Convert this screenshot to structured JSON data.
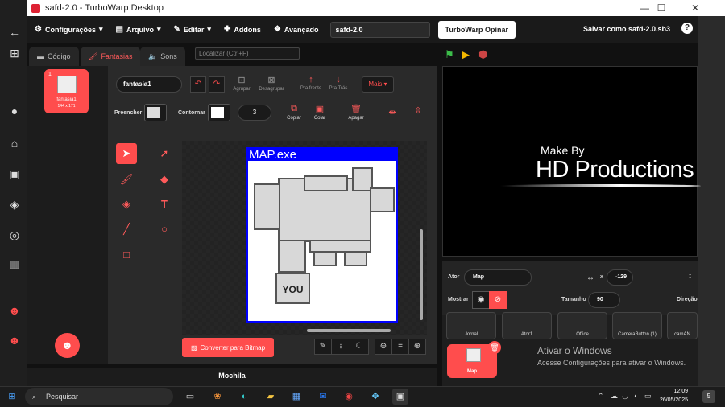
{
  "window": {
    "title": "safd-2.0 - TurboWarp Desktop",
    "minimize": "—",
    "maximize": "☐",
    "close": "✕"
  },
  "menubar": {
    "settings": "Configurações",
    "file": "Arquivo",
    "edit": "Editar",
    "addons": "Addons",
    "advanced": "Avançado",
    "project_name": "safd-2.0",
    "feedback_button": "TurboWarp Opinar",
    "save_as": "Salvar como safd-2.0.sb3",
    "help": "?"
  },
  "tabs": {
    "code": "Código",
    "costumes": "Fantasias",
    "sounds": "Sons"
  },
  "search": {
    "placeholder": "Localizar (Ctrl+F)"
  },
  "costume_list": {
    "items": [
      {
        "number": "1",
        "name": "fantasia1",
        "size": "144 x 171"
      }
    ]
  },
  "paint": {
    "costume_name": "fantasia1",
    "group": "Agrupar",
    "ungroup": "Desagrupar",
    "forward": "Pra frente",
    "backward": "Pra Trás",
    "more": "Mais",
    "fill_label": "Preencher",
    "outline_label": "Contornar",
    "outline_width": "3",
    "copy": "Copiar",
    "paste": "Colar",
    "delete": "Apagar",
    "convert_bitmap": "Converter para Bitmap",
    "zoom_reset": "="
  },
  "artwork": {
    "window_title": "MAP.exe",
    "player_label": "YOU"
  },
  "backpack": {
    "label": "Mochila"
  },
  "stage": {
    "line1": "Make By",
    "line2": "HD Productions"
  },
  "sprite_info": {
    "sprite_label": "Ator",
    "sprite_name": "Map",
    "x_label": "x",
    "x_value": "-129",
    "show_label": "Mostrar",
    "size_label": "Tamanho",
    "size_value": "90",
    "direction_label": "Direção"
  },
  "sprites": [
    "Jornal",
    "Ator1",
    "Office",
    "CameraButton (1)",
    "camAN"
  ],
  "selected_sprite": {
    "name": "Map"
  },
  "activation": {
    "line1": "Ativar o Windows",
    "line2": "Acesse Configurações para ativar o Windows."
  },
  "taskbar": {
    "search_placeholder": "Pesquisar",
    "time": "12:09",
    "date": "26/05/2025",
    "notifications": "5"
  },
  "colors": {
    "accent": "#ff4d4d",
    "art_border": "#0000ff",
    "fill_swatch": "#dddddd"
  }
}
